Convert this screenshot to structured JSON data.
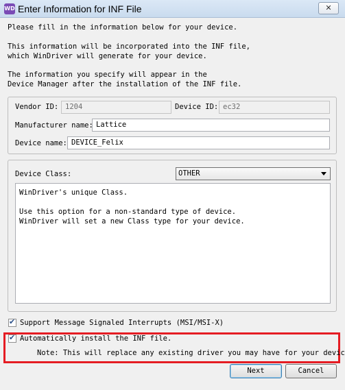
{
  "window": {
    "title": "Enter Information for INF File",
    "app_icon_text": "WD",
    "close_icon": "close-icon",
    "close_glyph": "✕"
  },
  "intro": {
    "line1": "Please fill in the information below for your device.",
    "para2": "This information will be incorporated into the INF file,\nwhich WinDriver will generate for your device.",
    "para3": "The information you specify will appear in the\nDevice Manager after the installation of the INF file."
  },
  "device_info": {
    "vendor_id_label": "Vendor ID:",
    "vendor_id_value": "1204",
    "device_id_label": "Device ID:",
    "device_id_value": "ec32",
    "manufacturer_label": "Manufacturer name:",
    "manufacturer_value": "Lattice",
    "device_name_label": "Device name:",
    "device_name_value": "DEVICE_Felix"
  },
  "device_class": {
    "label": "Device Class:",
    "selected": "OTHER",
    "description": "WinDriver's unique Class.\n\nUse this option for a non-standard type of device.\nWinDriver will set a new Class type for your device."
  },
  "options": {
    "msi_label": "Support Message Signaled Interrupts (MSI/MSI-X)",
    "msi_checked": true,
    "auto_install_label": "Automatically install the INF file.",
    "auto_install_checked": true,
    "note": "Note: This will replace any existing driver you may have for your device.",
    "check_glyph": "✔"
  },
  "buttons": {
    "next": "Next",
    "cancel": "Cancel"
  },
  "colors": {
    "highlight": "#e51c23",
    "title_bar": "#dbe8f6"
  }
}
